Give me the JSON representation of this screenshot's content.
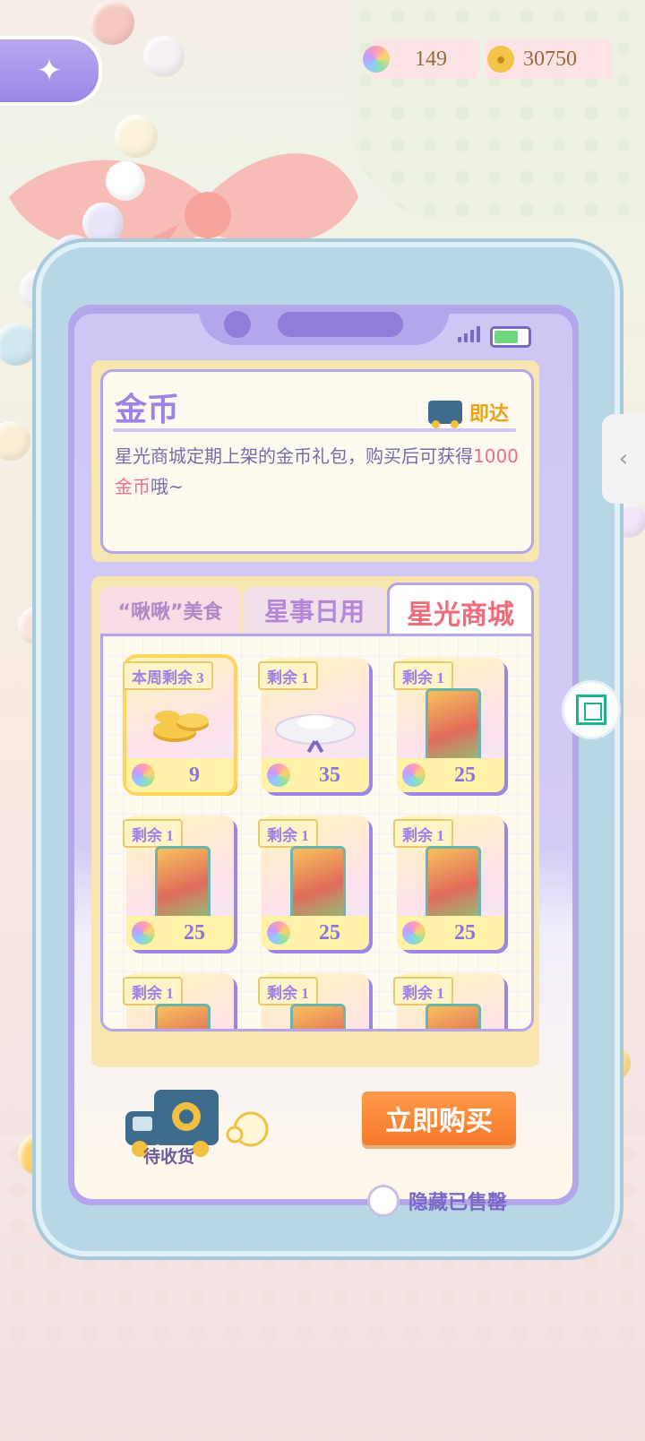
{
  "currency": {
    "stars": "149",
    "coins": "30750"
  },
  "info": {
    "title": "金币",
    "delivery": "即达",
    "desc_part1": "星光商城定期上架的金币礼包，购买后可获得",
    "desc_highlight": "1000金币",
    "desc_part2": "哦~"
  },
  "tabs": [
    {
      "label": "“啾啾”美食"
    },
    {
      "label": "星事日用"
    },
    {
      "label": "星光商城",
      "active": true
    }
  ],
  "items": [
    {
      "qty": "本周剩余 3",
      "price": "9",
      "icon": "gold-coins"
    },
    {
      "qty": "剩余 1",
      "price": "35",
      "icon": "cake-tray"
    },
    {
      "qty": "剩余 1",
      "price": "25",
      "icon": "character-card"
    },
    {
      "qty": "剩余 1",
      "price": "25",
      "icon": "character-card"
    },
    {
      "qty": "剩余 1",
      "price": "25",
      "icon": "character-card"
    },
    {
      "qty": "剩余 1",
      "price": "25",
      "icon": "character-card"
    },
    {
      "qty": "剩余 1",
      "price": "",
      "icon": "character-card"
    },
    {
      "qty": "剩余 1",
      "price": "",
      "icon": "character-card"
    },
    {
      "qty": "剩余 1",
      "price": "",
      "icon": "character-card"
    }
  ],
  "bottom": {
    "pending_label": "待收货",
    "buy_label": "立即购买",
    "hide_sold_label": "隐藏已售罄"
  },
  "colors": {
    "accent_purple": "#9c82e4",
    "buy_orange": "#f47a2a",
    "highlight_pink": "#f06c8a"
  }
}
